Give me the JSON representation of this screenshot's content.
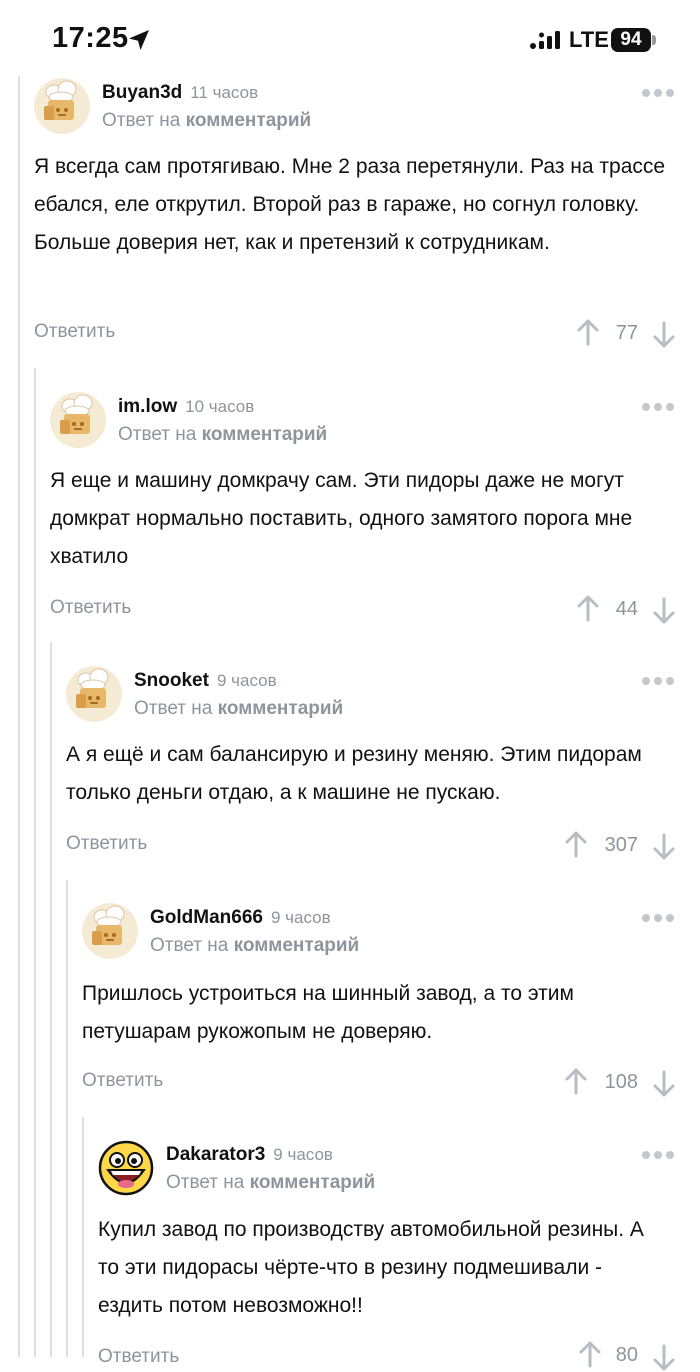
{
  "status": {
    "time": "17:25",
    "network": "LTE",
    "battery": "94"
  },
  "reply_to_prefix": "Ответ на",
  "reply_to_link": "комментарий",
  "answer_label": "Ответить",
  "comments": [
    {
      "author": "Buyan3d",
      "time": "11 часов",
      "avatar": "chef-hat-avatar",
      "text": "Я всегда сам протягиваю. Мне 2 раза перетянули. Раз на трассе ебался, еле открутил. Второй раз в гараже, но согнул головку. Больше доверия нет, как и претензий к сотрудникам.",
      "votes": "77"
    },
    {
      "author": "im.low",
      "time": "10 часов",
      "avatar": "chef-hat-avatar",
      "text": "Я еще и машину домкрачу сам. Эти пидоры даже не могут домкрат нормально поставить, одного замятого порога мне хватило",
      "votes": "44"
    },
    {
      "author": "Snooket",
      "time": "9 часов",
      "avatar": "chef-hat-avatar",
      "text": "А я ещё и сам балансирую и резину меняю. Этим пидорам только деньги отдаю, а к машине не пускаю.",
      "votes": "307"
    },
    {
      "author": "GoldMan666",
      "time": "9 часов",
      "avatar": "chef-hat-avatar",
      "text": "Пришлось устроиться на шинный завод, а то этим петушарам рукожопым не доверяю.",
      "votes": "108"
    },
    {
      "author": "Dakarator3",
      "time": "9 часов",
      "avatar": "laughing-face-avatar",
      "text": "Купил завод по производству автомобильной резины. А то эти пидорасы чёрте-что в резину подмешивали - ездить потом невозможно!!",
      "votes": "80"
    }
  ]
}
